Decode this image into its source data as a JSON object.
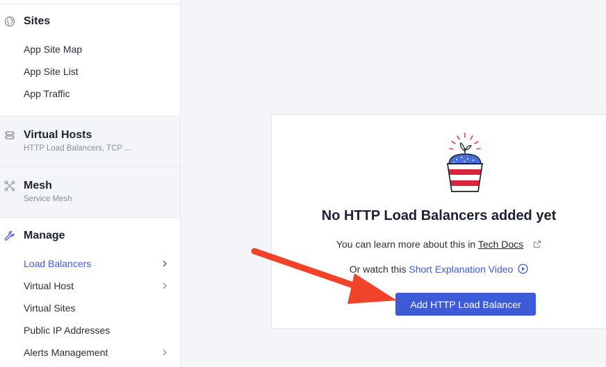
{
  "sidebar": {
    "sites": {
      "title": "Sites",
      "items": [
        "App Site Map",
        "App Site List",
        "App Traffic"
      ]
    },
    "virtual_hosts": {
      "title": "Virtual Hosts",
      "subtitle": "HTTP Load Balancers, TCP ..."
    },
    "mesh": {
      "title": "Mesh",
      "subtitle": "Service Mesh"
    },
    "manage": {
      "title": "Manage",
      "items": [
        "Load Balancers",
        "Virtual Host",
        "Virtual Sites",
        "Public IP Addresses",
        "Alerts Management"
      ]
    }
  },
  "empty_state": {
    "title": "No HTTP Load Balancers added yet",
    "learn_prefix": "You can learn more about this in",
    "learn_link": "Tech Docs",
    "watch_prefix": "Or watch this",
    "watch_link": "Short Explanation Video",
    "button_label": "Add HTTP Load Balancer"
  },
  "colors": {
    "accent": "#3d5bd9",
    "arrow": "#f0432a",
    "pot_red": "#d7263d",
    "soil_blue": "#4a6fd8"
  }
}
